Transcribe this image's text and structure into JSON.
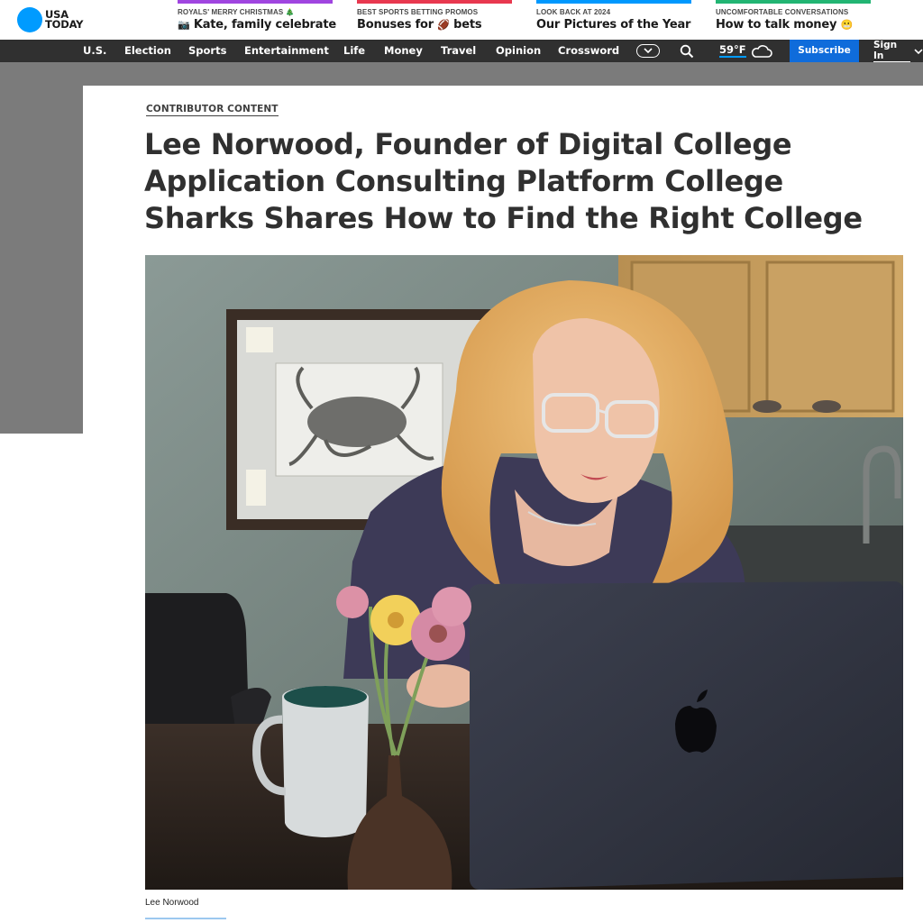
{
  "brand": {
    "line1": "USA",
    "line2": "TODAY",
    "color": "#009bff"
  },
  "trending": [
    {
      "kicker": "ROYALS' MERRY CHRISTMAS 🎄",
      "icon": "📷",
      "headline": "Kate, family celebrate",
      "rule_color": "#a045e0"
    },
    {
      "kicker": "BEST SPORTS BETTING PROMOS",
      "headline_pre": "Bonuses for ",
      "icon": "🏈",
      "headline_post": " bets",
      "rule_color": "#e8384f"
    },
    {
      "kicker": "LOOK BACK AT 2024",
      "headline": "Our Pictures of the Year",
      "rule_color": "#0098fe"
    },
    {
      "kicker": "UNCOMFORTABLE CONVERSATIONS",
      "headline": "How to talk money",
      "icon": "😬",
      "rule_color": "#22b573"
    }
  ],
  "nav": {
    "items": [
      "U.S.",
      "Election",
      "Sports",
      "Entertainment",
      "Life",
      "Money",
      "Travel",
      "Opinion",
      "Crossword"
    ],
    "more_icon": "chevron-down-icon",
    "search_icon": "search-icon",
    "weather_temp": "59°F",
    "weather_icon": "cloud-icon",
    "subscribe": "Subscribe",
    "signin": "Sign In"
  },
  "article": {
    "label": "CONTRIBUTOR CONTENT",
    "headline": "Lee Norwood, Founder of Digital College Application Consulting Platform College Sharks Shares How to Find the Right College",
    "photo_caption": "Lee Norwood"
  },
  "colors": {
    "nav_bg": "#303030",
    "subscribe_bg": "#0f6cdb",
    "backdrop": "#7b7b7b"
  }
}
